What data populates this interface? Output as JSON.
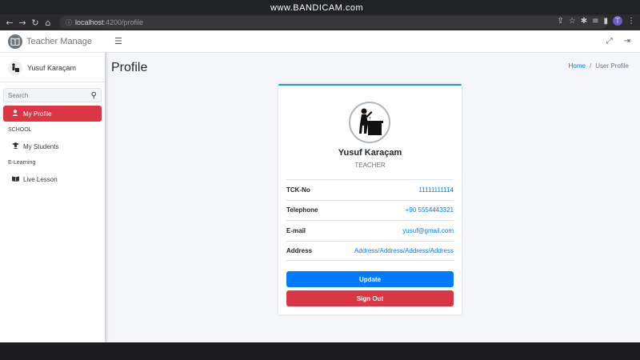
{
  "browser": {
    "url_host": "localhost",
    "url_path": ":4200/profile",
    "watermark": "www.BANDICAM.com",
    "profile_initial": "T"
  },
  "sidebar": {
    "brand": "Teacher Manage",
    "user_name": "Yusuf Karaçam",
    "search_placeholder": "Search",
    "active_item": "My Profile",
    "sections": [
      {
        "header": "SCHOOL",
        "items": [
          {
            "label": "My Students",
            "icon": "graduate-icon"
          }
        ]
      },
      {
        "header": "E-Learning",
        "items": [
          {
            "label": "Live Lesson",
            "icon": "book-icon"
          }
        ]
      }
    ]
  },
  "page": {
    "title": "Profile",
    "breadcrumb_home": "Home",
    "breadcrumb_sep": "/",
    "breadcrumb_current": "User Profile"
  },
  "profile": {
    "name": "Yusuf Karaçam",
    "role": "TEACHER",
    "fields": [
      {
        "label": "TCK-No",
        "value": "11111111114"
      },
      {
        "label": "Telephone",
        "value": "+90 5554443321"
      },
      {
        "label": "E-mail",
        "value": "yusuf@gmail.com"
      },
      {
        "label": "Address",
        "value": "Address/Address/Address/Address"
      }
    ],
    "update_label": "Update",
    "signout_label": "Sign Out"
  },
  "colors": {
    "primary": "#007bff",
    "danger": "#dc3545",
    "card_accent": "#17a2b8"
  }
}
